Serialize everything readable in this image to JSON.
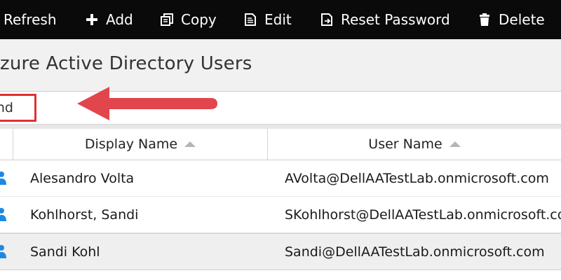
{
  "toolbar": {
    "items": [
      {
        "label": "Refresh",
        "icon": "refresh-icon"
      },
      {
        "label": "Add",
        "icon": "plus-icon"
      },
      {
        "label": "Copy",
        "icon": "copy-icon"
      },
      {
        "label": "Edit",
        "icon": "edit-icon"
      },
      {
        "label": "Reset Password",
        "icon": "reset-password-icon"
      },
      {
        "label": "Delete",
        "icon": "trash-icon"
      }
    ]
  },
  "page": {
    "title": "zure Active Directory Users"
  },
  "search": {
    "value": "nd",
    "highlight_color": "#e03131",
    "arrow_color": "#e0464b"
  },
  "table": {
    "columns": [
      {
        "label": "Display Name",
        "sort": "ascending"
      },
      {
        "label": "User Name",
        "sort": "ascending"
      }
    ],
    "rows": [
      {
        "display_name": "Alesandro Volta",
        "user_name": "AVolta@DellAATestLab.onmicrosoft.com",
        "selected": false
      },
      {
        "display_name": "Kohlhorst, Sandi",
        "user_name": "SKohlhorst@DellAATestLab.onmicrosoft.com",
        "selected": false
      },
      {
        "display_name": "Sandi Kohl",
        "user_name": "Sandi@DellAATestLab.onmicrosoft.com",
        "selected": true
      }
    ],
    "row_icon": "user-icon",
    "icon_color": "#1e88e5"
  }
}
